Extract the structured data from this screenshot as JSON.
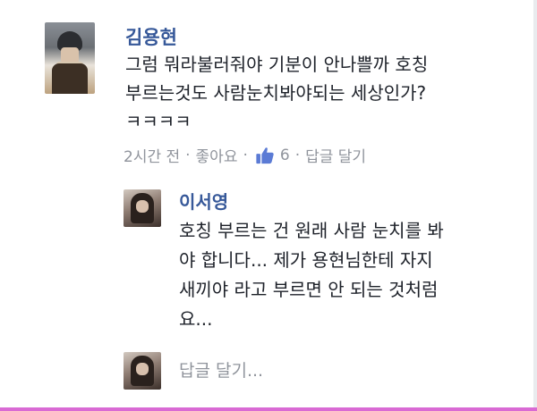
{
  "comment": {
    "author": "김용현",
    "text_lines": [
      "그럼 뭐라불러줘야 기분이 안나쁠까 호칭",
      "부르는것도 사람눈치봐야되는 세상인가?",
      "ㅋㅋㅋㅋ"
    ],
    "time": "2시간 전",
    "separator": "·",
    "like_label": "좋아요",
    "like_count": "6",
    "reply_label": "답글 달기",
    "like_icon": "thumbs-up-icon",
    "link_color": "#365899"
  },
  "reply": {
    "author": "이서영",
    "text_lines": [
      "호칭 부르는 건 원래 사람 눈치를 봐",
      "야 합니다... 제가 용현님한테 자지",
      "새끼야 라고 부르면 안 되는 것처럼",
      "요..."
    ]
  },
  "composer": {
    "placeholder": "답글 달기..."
  }
}
